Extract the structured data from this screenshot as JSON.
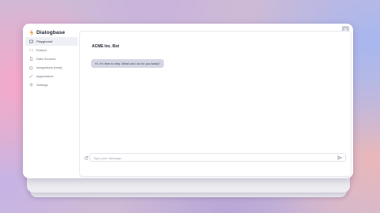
{
  "app": {
    "name": "Dialogbase"
  },
  "sidebar": {
    "items": [
      {
        "label": "Playground",
        "icon": "chat-bubble-icon",
        "active": true
      },
      {
        "label": "Embed",
        "icon": "code-icon",
        "active": false
      },
      {
        "label": "Data Sources",
        "icon": "file-icon",
        "active": false
      },
      {
        "label": "Integrations (beta)",
        "icon": "puzzle-icon",
        "active": false
      },
      {
        "label": "Appearance",
        "icon": "brush-icon",
        "active": false
      },
      {
        "label": "Settings",
        "icon": "gear-icon",
        "active": false
      }
    ]
  },
  "chat": {
    "title": "ACME Inc. Bot",
    "messages": [
      {
        "role": "bot",
        "text": "Hi, I'm here to help. What can I do for you today?"
      }
    ]
  },
  "composer": {
    "placeholder": "Type your message...",
    "value": ""
  },
  "colors": {
    "accent": "#f2a03d",
    "bubble": "#d4d7e3",
    "active_nav": "#eef0f5"
  }
}
